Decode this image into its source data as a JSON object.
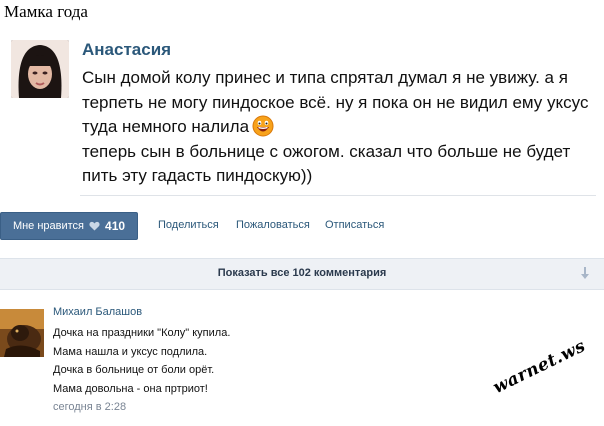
{
  "page": {
    "title": "Мамка года"
  },
  "post": {
    "author": "Анастасия",
    "lines": [
      "Сын домой колу принес и типа спрятал думал я не увижу. а я",
      "терпеть не могу пиндоское всё. ну я пока он не видил ему уксус",
      "туда немного налила",
      "теперь сын в больнице с ожогом. сказал что больше не будет",
      "пить эту гадасть пиндоскую))"
    ],
    "emoji_icon": "laughing-smiley-icon"
  },
  "actions": {
    "like_label": "Мне нравится",
    "like_count": "410",
    "share_label": "Поделиться",
    "report_label": "Пожаловаться",
    "unsubscribe_label": "Отписаться"
  },
  "comments_bar": {
    "label": "Показать все 102 комментария"
  },
  "comment": {
    "author": "Михаил Балашов",
    "lines": [
      "Дочка на праздники \"Колу\" купила.",
      "Мама нашла и уксус подлила.",
      "Дочка в больнице от боли орёт.",
      "Мама довольна - она пртриот!"
    ],
    "time": "сегодня в 2:28"
  },
  "watermark": {
    "text": "warnet.ws"
  },
  "colors": {
    "link": "#2b587a",
    "like_button": "#4a6f97",
    "comments_bar_bg": "#eef1f5"
  }
}
